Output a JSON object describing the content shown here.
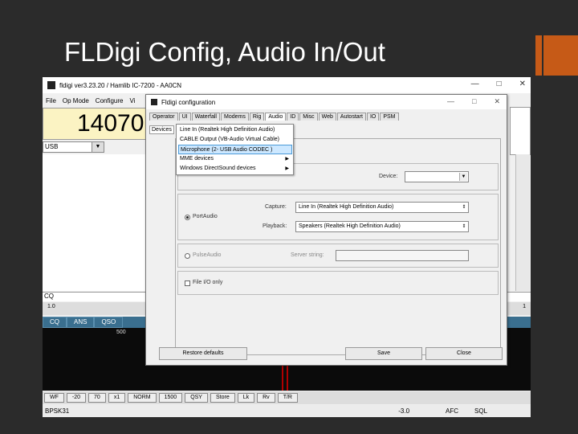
{
  "slide": {
    "title": "FLDigi Config, Audio In/Out",
    "accent_color": "#c65a17"
  },
  "app": {
    "title": "fldigi ver3.23.20 / Hamlib IC-7200 - AA0CN",
    "menu": [
      "File",
      "Op Mode",
      "Configure",
      "Vi"
    ],
    "frequency": "14070",
    "mode": "USB",
    "rx_text": "CQ",
    "ctrl_buttons": [
      "CQ",
      "ANS",
      "QSO"
    ],
    "waterfall_label": "500",
    "bottom_buttons": [
      "WF",
      "-20",
      "70",
      "x1",
      "NORM",
      "1500",
      "QSY",
      "Store",
      "Lk",
      "Rv",
      "T/R"
    ],
    "status_mode": "BPSK31",
    "status_value": "-3.0",
    "afc_label": "AFC",
    "sql_label": "SQL",
    "right_label": "1",
    "signal_label": "1.0"
  },
  "dialog": {
    "title": "Fldigi configuration",
    "tabs": [
      "Operator",
      "UI",
      "Waterfall",
      "Modems",
      "Rig",
      "Audio",
      "ID",
      "Misc",
      "Web",
      "Autostart",
      "IO",
      "PSM"
    ],
    "active_tab": "Audio",
    "subtab": "Devices",
    "device_label": "Device:",
    "capture_label": "Capture:",
    "capture_value": "Line In (Realtek High Definition Audio)",
    "playback_label": "Playback:",
    "playback_value": "Speakers (Realtek High Definition Audio)",
    "portaudio_label": "PortAudio",
    "pulseaudio_label": "PulseAudio",
    "server_label": "Server string:",
    "file_label": "File I/O only",
    "restore_label": "Restore defaults",
    "save_label": "Save",
    "close_label": "Close"
  },
  "dropdown": {
    "items": [
      {
        "label": "Line In (Realtek High Definition Audio)"
      },
      {
        "label": "CABLE Output (VB-Audio Virtual Cable)"
      },
      {
        "label": "Microphone (2- USB Audio CODEC )"
      },
      {
        "label": "MME devices"
      },
      {
        "label": "Windows DirectSound devices"
      }
    ],
    "selected_index": 2
  }
}
